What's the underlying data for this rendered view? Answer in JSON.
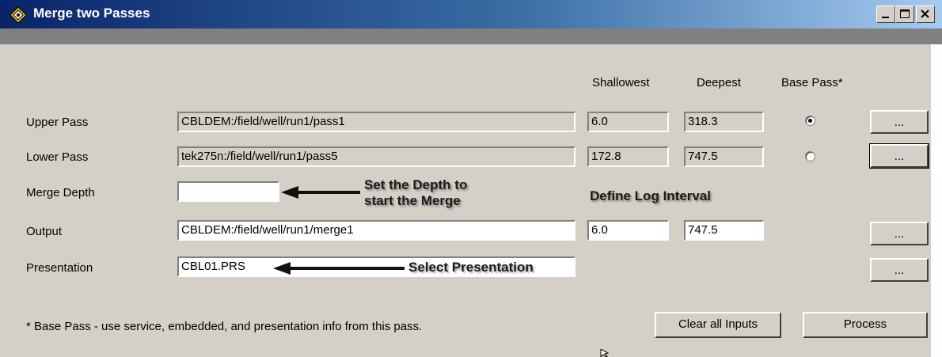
{
  "window": {
    "title": "Merge two Passes",
    "colors": {
      "titlebar": "#0a246a",
      "face": "#d4d0c8",
      "menubar": "#808080"
    }
  },
  "columns": {
    "shallowest": "Shallowest",
    "deepest": "Deepest",
    "base_pass": "Base Pass*"
  },
  "rows": {
    "upper": {
      "label": "Upper Pass",
      "path": "CBLDEM:/field/well/run1/pass1",
      "shallowest": "6.0",
      "deepest": "318.3",
      "base_selected": true,
      "browse": "..."
    },
    "lower": {
      "label": "Lower Pass",
      "path": "tek275n:/field/well/run1/pass5",
      "shallowest": "172.8",
      "deepest": "747.5",
      "base_selected": false,
      "browse": "..."
    },
    "merge_depth": {
      "label": "Merge Depth",
      "value": ""
    },
    "output": {
      "label": "Output",
      "path": "CBLDEM:/field/well/run1/merge1",
      "shallowest": "6.0",
      "deepest": "747.5",
      "browse": "..."
    },
    "presentation": {
      "label": "Presentation",
      "value": "CBL01.PRS",
      "browse": "..."
    }
  },
  "annotations": {
    "merge_depth_line1": "Set the Depth to",
    "merge_depth_line2": "start the Merge",
    "log_interval": "Define Log Interval",
    "presentation": "Select Presentation"
  },
  "footer": {
    "note": "* Base Pass - use service, embedded, and presentation info from this pass.",
    "clear_button": "Clear all Inputs",
    "process_button": "Process"
  }
}
